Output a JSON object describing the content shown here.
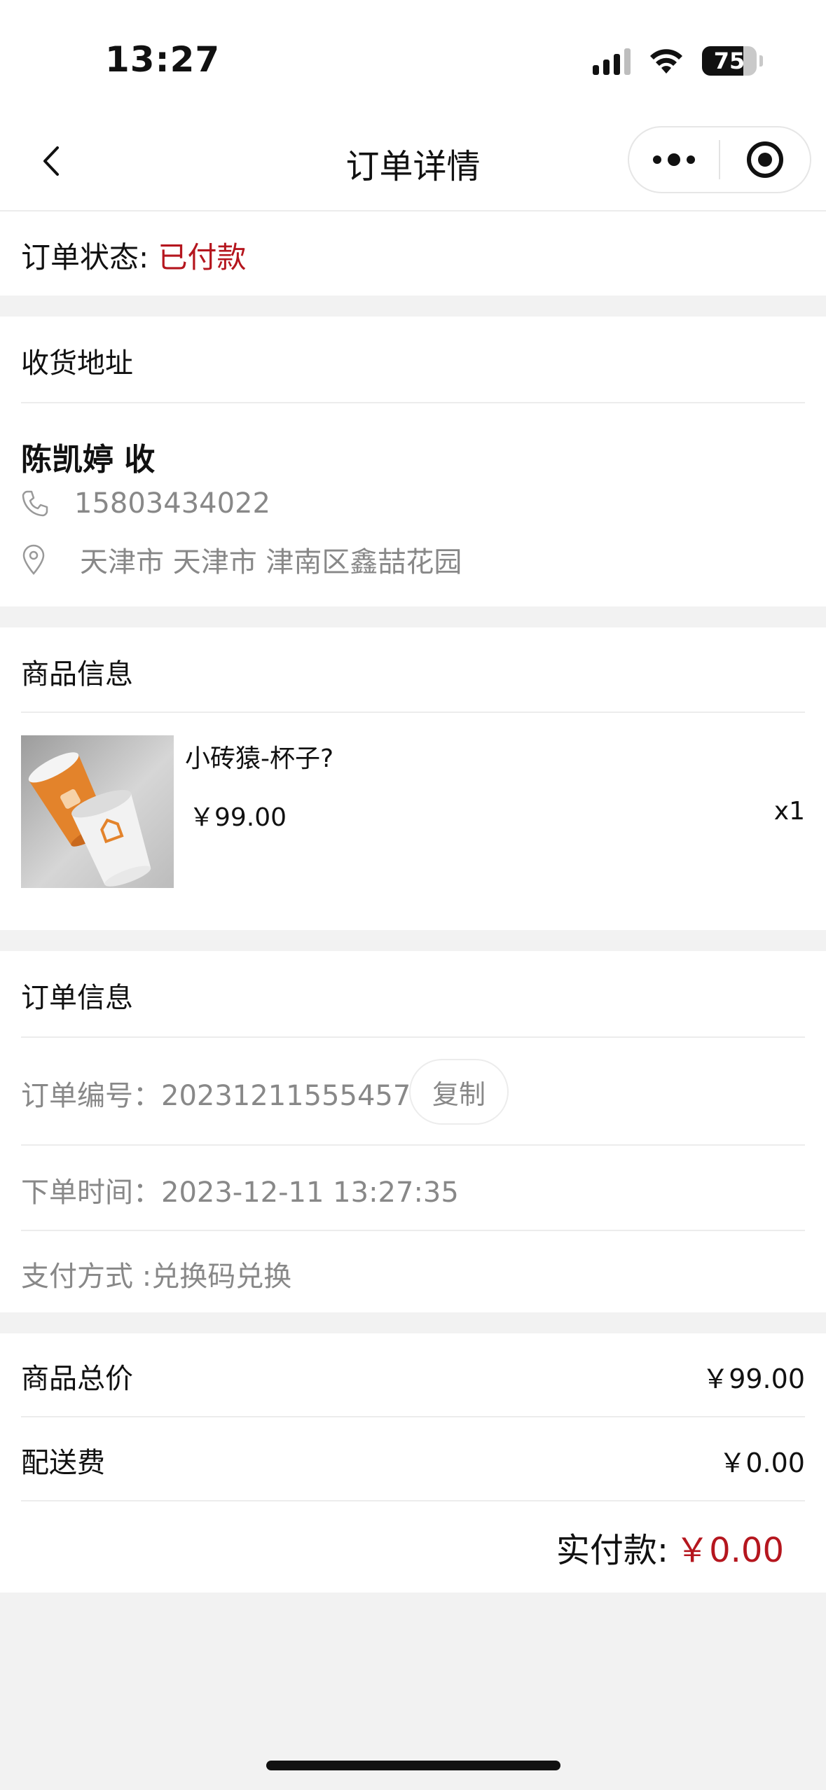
{
  "status_bar": {
    "time": "13:27",
    "battery": "75",
    "battery_level": 0.75
  },
  "nav": {
    "title": "订单详情"
  },
  "order_status": {
    "label": "订单状态: ",
    "value": "已付款"
  },
  "address": {
    "title": "收货地址",
    "name": "陈凯婷 收",
    "phone": "15803434022",
    "detail": "天津市 天津市 津南区鑫喆花园"
  },
  "goods": {
    "title": "商品信息",
    "name": "小砖猿-杯子?",
    "price": "￥99.00",
    "qty": "x1"
  },
  "order_info": {
    "title": "订单信息",
    "number_line": "订单编号：2023121155545750",
    "copy_label": "复制",
    "time_line": "下单时间：2023-12-11 13:27:35",
    "pay_line": "支付方式 :兑换码兑换"
  },
  "totals": {
    "goods_total_label": "商品总价",
    "goods_total_value": "￥99.00",
    "shipping_label": "配送费",
    "shipping_value": "￥0.00",
    "paid_label": "实付款:",
    "paid_value": "￥0.00"
  },
  "colors": {
    "accent_red": "#b5161e",
    "muted_text": "#888888",
    "page_bg": "#f2f2f2"
  }
}
